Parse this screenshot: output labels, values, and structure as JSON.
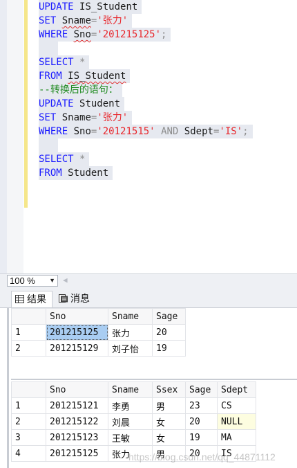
{
  "editor": {
    "lines": [
      {
        "parts": [
          {
            "t": "UPDATE",
            "c": "kw"
          },
          {
            "t": " ",
            "c": "id"
          },
          {
            "t": "IS_Student",
            "c": "id"
          }
        ]
      },
      {
        "parts": [
          {
            "t": "SET",
            "c": "kw"
          },
          {
            "t": " ",
            "c": "id"
          },
          {
            "t": "Sname",
            "c": "id squig"
          },
          {
            "t": "=",
            "c": "op"
          },
          {
            "t": "'张力'",
            "c": "str"
          }
        ]
      },
      {
        "parts": [
          {
            "t": "WHERE",
            "c": "kw"
          },
          {
            "t": " ",
            "c": "id"
          },
          {
            "t": "Sno",
            "c": "id squig"
          },
          {
            "t": "=",
            "c": "op"
          },
          {
            "t": "'201215125'",
            "c": "str"
          },
          {
            "t": ";",
            "c": "op"
          }
        ]
      },
      {
        "parts": []
      },
      {
        "parts": [
          {
            "t": "SELECT",
            "c": "kw"
          },
          {
            "t": " ",
            "c": "id"
          },
          {
            "t": "*",
            "c": "op"
          }
        ]
      },
      {
        "parts": [
          {
            "t": "FROM",
            "c": "kw"
          },
          {
            "t": " ",
            "c": "id"
          },
          {
            "t": "IS_Student",
            "c": "id squig"
          }
        ]
      },
      {
        "parts": [
          {
            "t": "--转换后的语句：",
            "c": "cm"
          }
        ]
      },
      {
        "parts": [
          {
            "t": "UPDATE",
            "c": "kw"
          },
          {
            "t": " ",
            "c": "id"
          },
          {
            "t": "Student",
            "c": "id"
          }
        ]
      },
      {
        "parts": [
          {
            "t": "SET",
            "c": "kw"
          },
          {
            "t": " ",
            "c": "id"
          },
          {
            "t": "Sname",
            "c": "id"
          },
          {
            "t": "=",
            "c": "op"
          },
          {
            "t": "'张力'",
            "c": "str"
          }
        ]
      },
      {
        "parts": [
          {
            "t": "WHERE",
            "c": "kw"
          },
          {
            "t": " ",
            "c": "id"
          },
          {
            "t": "Sno",
            "c": "id"
          },
          {
            "t": "=",
            "c": "op"
          },
          {
            "t": "'20121515'",
            "c": "str"
          },
          {
            "t": " ",
            "c": "id"
          },
          {
            "t": "AND",
            "c": "op"
          },
          {
            "t": " ",
            "c": "id"
          },
          {
            "t": "Sdept",
            "c": "id"
          },
          {
            "t": "=",
            "c": "op"
          },
          {
            "t": "'IS'",
            "c": "str"
          },
          {
            "t": ";",
            "c": "op"
          }
        ]
      },
      {
        "parts": []
      },
      {
        "parts": [
          {
            "t": "SELECT",
            "c": "kw"
          },
          {
            "t": " ",
            "c": "id"
          },
          {
            "t": "*",
            "c": "op"
          }
        ]
      },
      {
        "parts": [
          {
            "t": "FROM",
            "c": "kw"
          },
          {
            "t": " ",
            "c": "id"
          },
          {
            "t": "Student",
            "c": "id"
          }
        ]
      }
    ]
  },
  "zoom": {
    "value": "100 %"
  },
  "tabs": {
    "results": "结果",
    "messages": "消息"
  },
  "grid1": {
    "columns": [
      "Sno",
      "Sname",
      "Sage"
    ],
    "rows": [
      [
        "1",
        "201215125",
        "张力",
        "20"
      ],
      [
        "2",
        "201215129",
        "刘子怡",
        "19"
      ]
    ]
  },
  "grid2": {
    "columns": [
      "Sno",
      "Sname",
      "Ssex",
      "Sage",
      "Sdept"
    ],
    "rows": [
      [
        "1",
        "201215121",
        "李勇",
        "男",
        "23",
        "CS"
      ],
      [
        "2",
        "201215122",
        "刘晨",
        "女",
        "20",
        "NULL"
      ],
      [
        "3",
        "201215123",
        "王敏",
        "女",
        "19",
        "MA"
      ],
      [
        "4",
        "201215125",
        "张力",
        "男",
        "20",
        "IS"
      ]
    ]
  },
  "watermark": "https://blog.csdn.net/qq_44871112"
}
